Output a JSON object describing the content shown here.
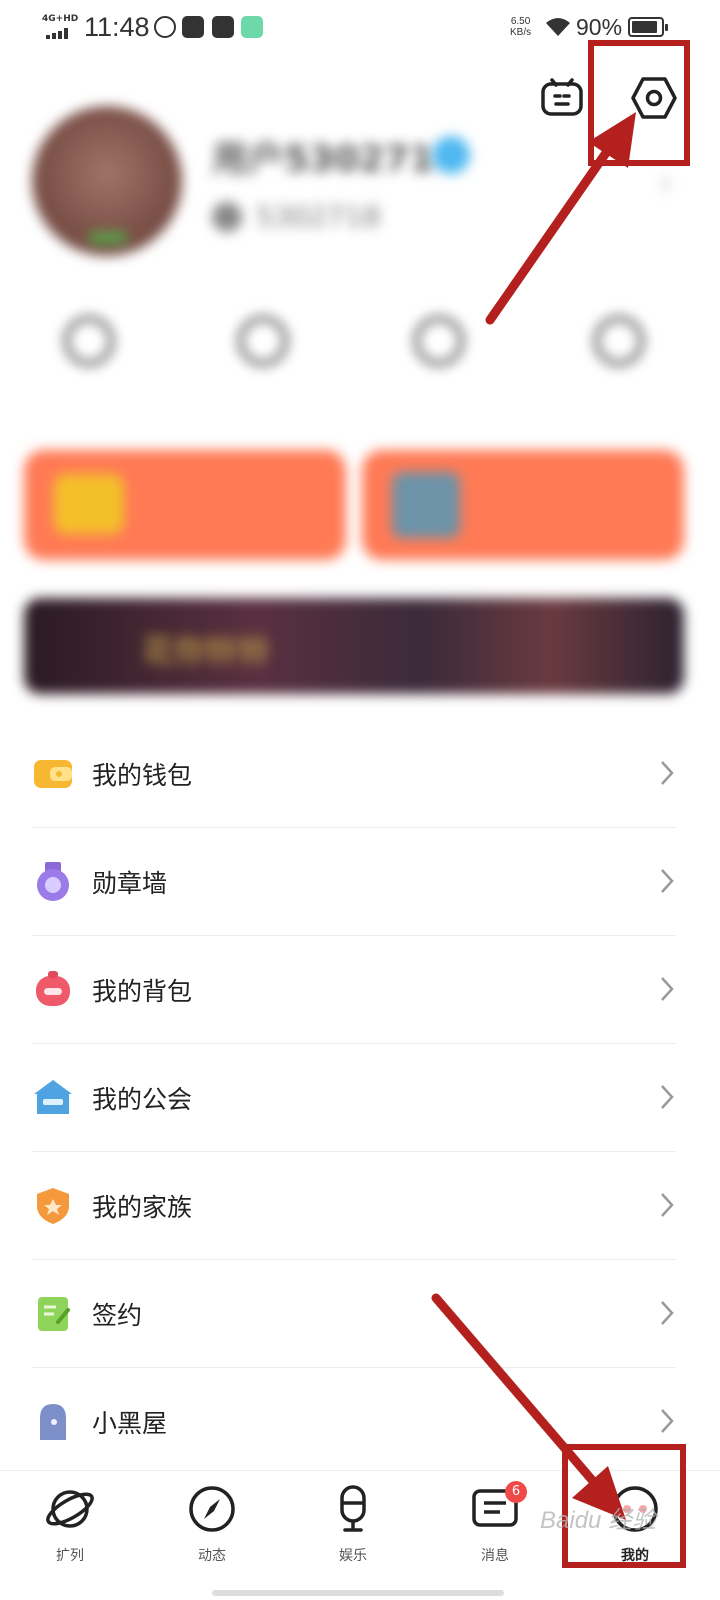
{
  "status_bar": {
    "network": "4G+HD",
    "time": "11:48",
    "speed_value": "6.50",
    "speed_unit": "KB/s",
    "battery_text": "90%",
    "battery_level": 0.9
  },
  "profile": {
    "username": "用户5302718",
    "uid": "5302718"
  },
  "banner": {
    "text": "花你铃铃"
  },
  "menu": {
    "items": [
      {
        "label": "我的钱包",
        "icon": "wallet-icon",
        "color": "#f7b731"
      },
      {
        "label": "勋章墙",
        "icon": "medal-icon",
        "color": "#9b7be8"
      },
      {
        "label": "我的背包",
        "icon": "backpack-icon",
        "color": "#ef5a6a"
      },
      {
        "label": "我的公会",
        "icon": "guild-icon",
        "color": "#4fa3e0"
      },
      {
        "label": "我的家族",
        "icon": "family-shield-icon",
        "color": "#f59a3c"
      },
      {
        "label": "签约",
        "icon": "contract-icon",
        "color": "#8fd45a"
      },
      {
        "label": "小黑屋",
        "icon": "ghost-icon",
        "color": "#7d8fc8"
      }
    ]
  },
  "bottom_nav": {
    "items": [
      {
        "label": "扩列",
        "icon": "planet-icon"
      },
      {
        "label": "动态",
        "icon": "compass-icon"
      },
      {
        "label": "娱乐",
        "icon": "microphone-icon"
      },
      {
        "label": "消息",
        "icon": "message-icon",
        "badge": "6"
      },
      {
        "label": "我的",
        "icon": "profile-face-icon",
        "active": true
      }
    ]
  },
  "annotation": {
    "color": "#b3201e"
  },
  "watermark": "Baidu 经验"
}
